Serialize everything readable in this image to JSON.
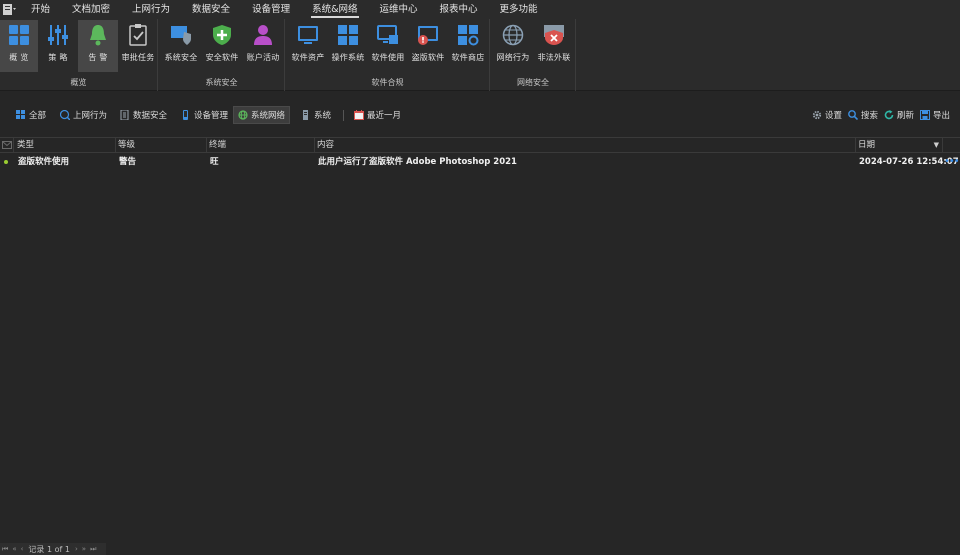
{
  "menu": {
    "items": [
      "开始",
      "文档加密",
      "上网行为",
      "数据安全",
      "设备管理",
      "系统&网络",
      "运维中心",
      "报表中心",
      "更多功能"
    ],
    "active_index": 5
  },
  "ribbon": {
    "groups": [
      {
        "label": "概览",
        "buttons": [
          {
            "label": "概 览",
            "icon": "overview-grid-icon",
            "selected": false,
            "highlight": true
          },
          {
            "label": "策 略",
            "icon": "policy-sliders-icon",
            "selected": false
          },
          {
            "label": "告 警",
            "icon": "alarm-bell-icon",
            "selected": true
          },
          {
            "label": "审批任务",
            "icon": "approval-task-icon",
            "selected": false
          }
        ]
      },
      {
        "label": "系统安全",
        "buttons": [
          {
            "label": "系统安全",
            "icon": "system-security-shield-icon"
          },
          {
            "label": "安全软件",
            "icon": "security-software-shield-icon"
          },
          {
            "label": "账户活动",
            "icon": "account-activity-user-icon"
          }
        ]
      },
      {
        "label": "软件合规",
        "buttons": [
          {
            "label": "软件资产",
            "icon": "software-assets-icon"
          },
          {
            "label": "操作系统",
            "icon": "operating-system-icon"
          },
          {
            "label": "软件使用",
            "icon": "software-usage-icon"
          },
          {
            "label": "盗版软件",
            "icon": "pirated-software-icon"
          },
          {
            "label": "软件商店",
            "icon": "software-store-icon"
          }
        ]
      },
      {
        "label": "网络安全",
        "buttons": [
          {
            "label": "网络行为",
            "icon": "network-behavior-globe-icon"
          },
          {
            "label": "非法外联",
            "icon": "illegal-outbound-icon"
          }
        ]
      }
    ]
  },
  "toolbar": {
    "filters": [
      {
        "label": "全部",
        "icon": "all-icon"
      },
      {
        "label": "上网行为",
        "icon": "web-behavior-icon"
      },
      {
        "label": "数据安全",
        "icon": "data-security-icon"
      },
      {
        "label": "设备管理",
        "icon": "device-management-icon"
      },
      {
        "label": "系统网络",
        "icon": "system-network-icon",
        "selected": true
      },
      {
        "label": "系统",
        "icon": "system-icon"
      }
    ],
    "range": {
      "label": "最近一月",
      "icon": "calendar-icon"
    },
    "actions": [
      {
        "label": "设置",
        "icon": "gear-icon"
      },
      {
        "label": "搜索",
        "icon": "search-icon"
      },
      {
        "label": "刷新",
        "icon": "refresh-icon"
      },
      {
        "label": "导出",
        "icon": "export-icon"
      }
    ]
  },
  "grid": {
    "columns": [
      "类型",
      "等级",
      "终端",
      "内容",
      "日期"
    ],
    "rows": [
      {
        "type": "盗版软件使用",
        "level": "警告",
        "terminal": "旺",
        "content": "此用户运行了盗版软件 Adobe Photoshop 2021",
        "date": "2024-07-26 12:54:07"
      }
    ]
  },
  "footer": {
    "record_text": "记录 1 of 1"
  },
  "colors": {
    "background": "#262626",
    "ribbon": "#2b2b2b",
    "accent_blue": "#3b8ee8",
    "alarm_green": "#5cb85c",
    "status_dot": "#9acd32"
  }
}
